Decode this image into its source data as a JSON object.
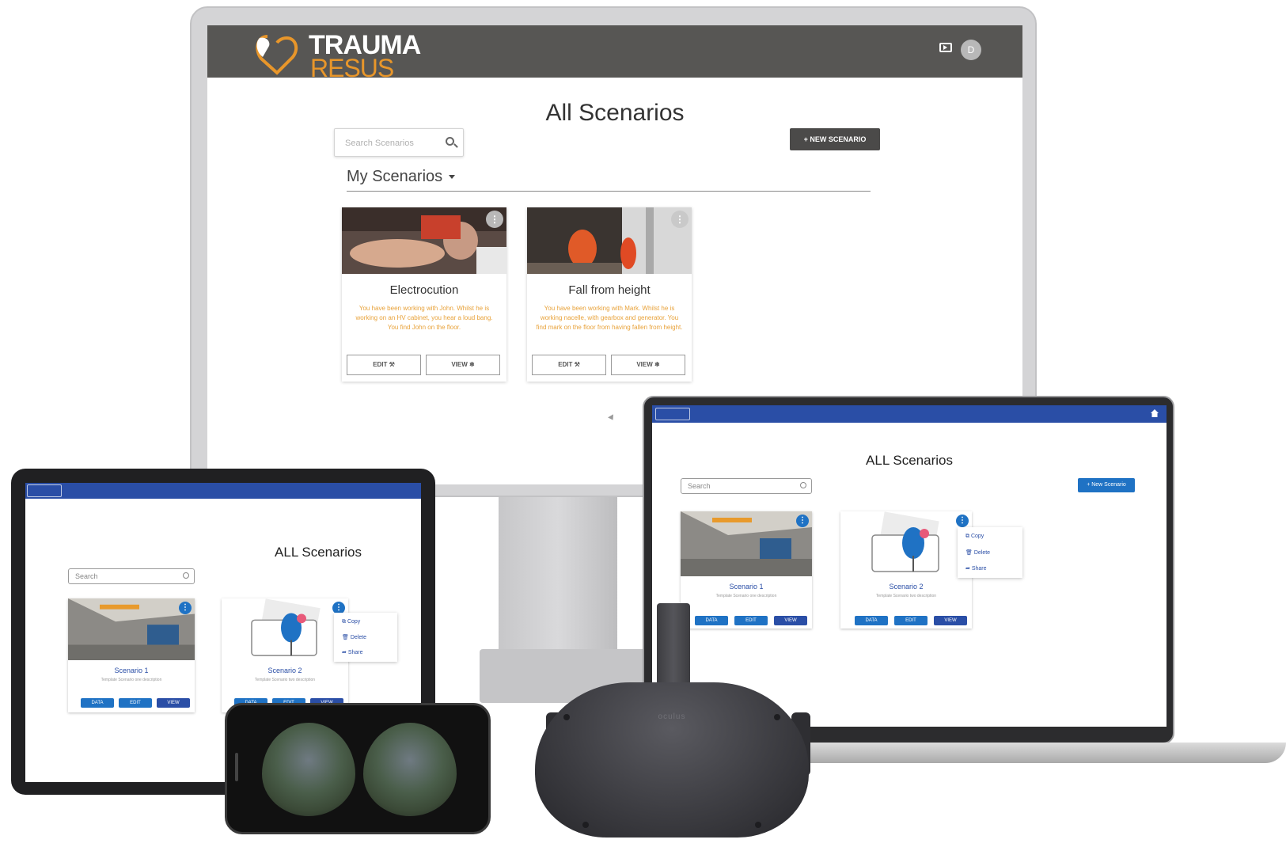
{
  "monitor": {
    "logo": {
      "line1": "TRAUMA",
      "line2": "RESUS"
    },
    "avatar_initial": "D",
    "title": "All Scenarios",
    "search_placeholder": "Search Scenarios",
    "new_scenario_label": "+ NEW SCENARIO",
    "section_label": "My Scenarios",
    "cards": [
      {
        "title": "Electrocution",
        "description": "You have been working with John. Whilst he is working on an HV cabinet, you hear a loud bang. You find John on the floor.",
        "edit_label": "EDIT ⚒",
        "view_label": "VIEW ❄"
      },
      {
        "title": "Fall from height",
        "description": "You have been working with Mark. Whilst he is working nacelle, with gearbox and generator. You find mark on the floor from having fallen from height.",
        "edit_label": "EDIT ⚒",
        "view_label": "VIEW ❄"
      }
    ]
  },
  "laptop": {
    "title": "ALL Scenarios",
    "search_placeholder": "Search",
    "new_scenario_label": "+ New Scenario",
    "cards": [
      {
        "title": "Scenario 1",
        "description": "Template Scenario one description"
      },
      {
        "title": "Scenario 2",
        "description": "Template Scenario two description"
      }
    ],
    "buttons": {
      "data": "DATA",
      "edit": "EDIT",
      "view": "VIEW"
    },
    "menu": {
      "copy": "Copy",
      "delete": "Delete",
      "share": "Share"
    }
  },
  "tablet": {
    "title": "ALL Scenarios",
    "search_placeholder": "Search",
    "cards": [
      {
        "title": "Scenario 1",
        "description": "Template Scenario one description"
      },
      {
        "title": "Scenario 2",
        "description": "Template Scenario two description"
      }
    ],
    "buttons": {
      "data": "DATA",
      "edit": "EDIT",
      "view": "VIEW"
    },
    "menu": {
      "copy": "Copy",
      "delete": "Delete",
      "share": "Share"
    }
  },
  "headset": {
    "brand": "oculus"
  },
  "colors": {
    "brand_orange": "#e8962a",
    "header_grey": "#575654",
    "nhs_blue": "#2a4ea6",
    "button_blue": "#1f72c4"
  }
}
